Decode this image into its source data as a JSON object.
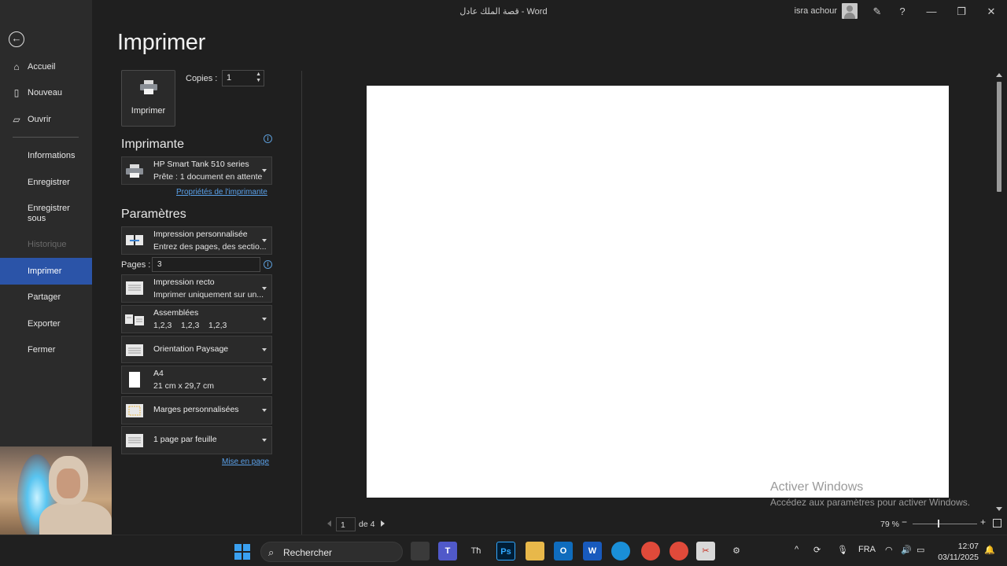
{
  "window": {
    "title": "قصة الملك عادل  -  Word",
    "user_name": "isra achour",
    "minimize": "—",
    "restore": "❐",
    "close": "✕",
    "help": "?"
  },
  "sidebar": {
    "back_icon": "←",
    "items": [
      {
        "label": "Accueil",
        "icon": "home-icon"
      },
      {
        "label": "Nouveau",
        "icon": "new-doc-icon"
      },
      {
        "label": "Ouvrir",
        "icon": "folder-open-icon"
      },
      {
        "label": "Informations"
      },
      {
        "label": "Enregistrer"
      },
      {
        "label": "Enregistrer sous"
      },
      {
        "label": "Historique"
      },
      {
        "label": "Imprimer"
      },
      {
        "label": "Partager"
      },
      {
        "label": "Exporter"
      },
      {
        "label": "Fermer"
      }
    ],
    "active": "Imprimer"
  },
  "print": {
    "title": "Imprimer",
    "print_button": "Imprimer",
    "copies_label": "Copies :",
    "copies_value": "1",
    "printer_heading": "Imprimante",
    "printer_name": "HP Smart Tank 510 series",
    "printer_status": "Prête : 1 document en attente",
    "printer_props_link": "Propriétés de l'imprimante",
    "settings_heading": "Paramètres",
    "range_l1": "Impression personnalisée",
    "range_l2": "Entrez des pages, des sectio...",
    "pages_label": "Pages :",
    "pages_value": "3",
    "sides_l1": "Impression recto",
    "sides_l2": "Imprimer uniquement sur un...",
    "collate_l1": "Assemblées",
    "collate_l2": "1,2,3    1,2,3    1,2,3",
    "orientation_l1": "Orientation Paysage",
    "paper_l1": "A4",
    "paper_l2": "21 cm x 29,7 cm",
    "margins_l1": "Marges personnalisées",
    "perpage_l1": "1 page par feuille",
    "page_setup_link": "Mise en page"
  },
  "preview": {
    "page_current": "1",
    "page_of": "de 4",
    "zoom": "79 %",
    "zoom_minus": "−",
    "zoom_plus": "+",
    "activate_title": "Activer Windows",
    "activate_sub": "Accédez aux paramètres pour activer Windows."
  },
  "taskbar": {
    "search_placeholder": "Rechercher",
    "lang": "FRA",
    "time": "12:07",
    "date": "03/11/2025",
    "chevron": "^"
  },
  "colors": {
    "accent": "#2b54a8",
    "link": "#5aa0e8",
    "background": "#1f1f1f",
    "sidebar": "#2b2b2b"
  }
}
